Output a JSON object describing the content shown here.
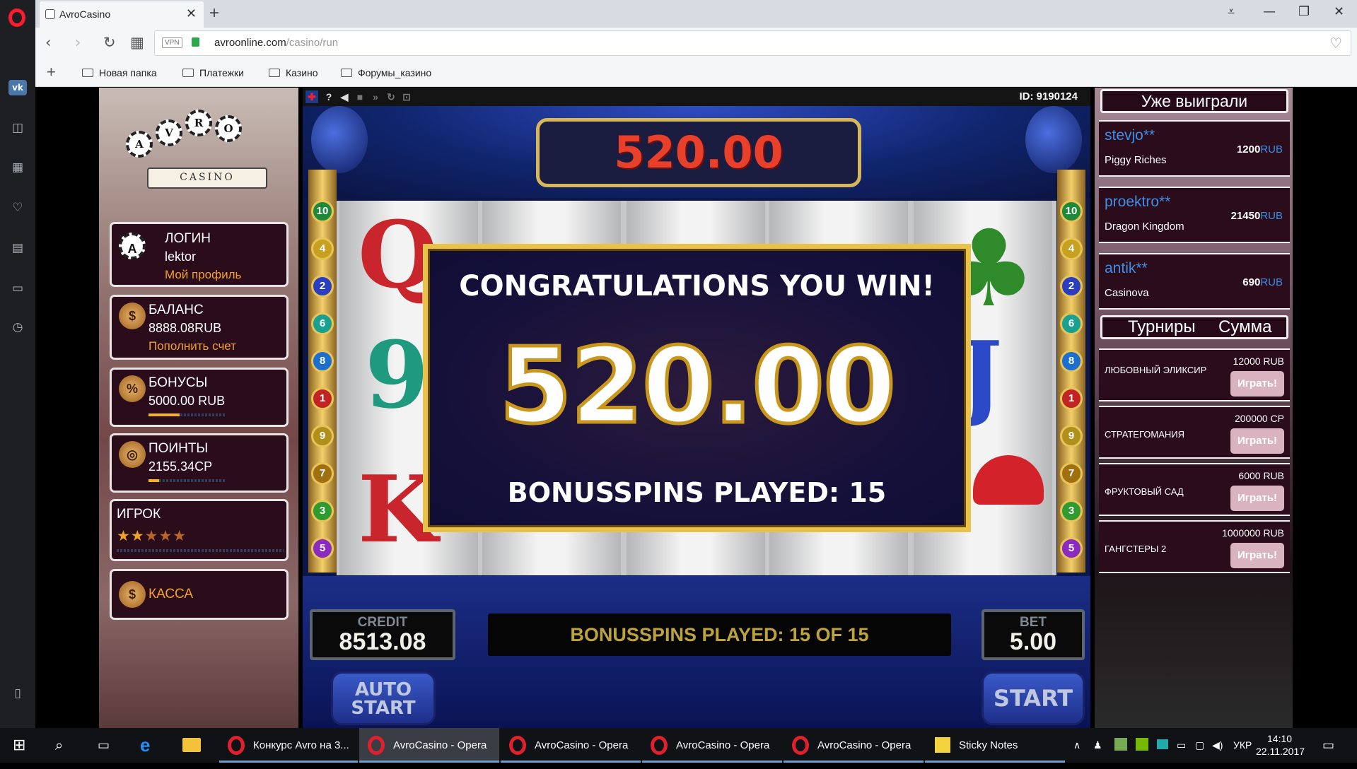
{
  "browser": {
    "tab_title": "AvroCasino",
    "url_host": "avroonline.com",
    "url_path": "/casino/run",
    "vpn_label": "VPN",
    "bookmarks": [
      "Новая папка",
      "Платежки",
      "Казино",
      "Форумы_казино"
    ]
  },
  "casino": {
    "logo_text": "CASINO",
    "logo_letters": [
      "A",
      "V",
      "R",
      "O"
    ],
    "login": {
      "title": "ЛОГИН",
      "user": "lektor",
      "link": "Мой профиль"
    },
    "balance": {
      "title": "БАЛАНС",
      "value": "8888.08RUB",
      "link": "Пополнить счет"
    },
    "bonus": {
      "title": "БОНУСЫ",
      "value": "5000.00 RUB",
      "progress": 0.4
    },
    "points": {
      "title": "ПОИНТЫ",
      "value": "2155.34CP",
      "progress": 0.14
    },
    "player": {
      "title": "ИГРОК",
      "stars": "★★★★★",
      "stars_rated": 2
    },
    "cashier": {
      "title": "КАССА"
    }
  },
  "game": {
    "id_label": "ID: 9190124",
    "top_win": "520.00",
    "popup_title": "CONGRATULATIONS YOU WIN!",
    "popup_amount": "520.00",
    "popup_spins": "BONUSSPINS PLAYED: 15",
    "line_numbers": [
      "10",
      "4",
      "2",
      "6",
      "8",
      "1",
      "9",
      "7",
      "3",
      "5"
    ],
    "credit_label": "CREDIT",
    "credit_value": "8513.08",
    "status": "BONUSSPINS PLAYED: 15 OF 15",
    "bet_label": "BET",
    "bet_value": "5.00",
    "auto_start_line1": "AUTO",
    "auto_start_line2": "START",
    "start": "START"
  },
  "winners": {
    "heading": "Уже выиграли",
    "items": [
      {
        "name": "stevjo**",
        "game": "Piggy Riches",
        "amount": "1200",
        "currency": "RUB"
      },
      {
        "name": "proektro**",
        "game": "Dragon Kingdom",
        "amount": "21450",
        "currency": "RUB"
      },
      {
        "name": "antik**",
        "game": "Casinova",
        "amount": "690",
        "currency": "RUB"
      }
    ]
  },
  "tournaments": {
    "heading_left": "Турниры",
    "heading_right": "Сумма",
    "play_label": "Играть!",
    "items": [
      {
        "name": "ЛЮБОВНЫЙ ЭЛИКСИР",
        "prize": "12000 RUB"
      },
      {
        "name": "СТРАТЕГОМАНИЯ",
        "prize": "200000 CP"
      },
      {
        "name": "ФРУКТОВЫЙ САД",
        "prize": "6000 RUB"
      },
      {
        "name": "ГАНГСТЕРЫ 2",
        "prize": "1000000 RUB"
      }
    ]
  },
  "taskbar": {
    "apps": [
      "Конкурс Avro на 3...",
      "AvroCasino - Opera",
      "AvroCasino - Opera",
      "AvroCasino - Opera",
      "AvroCasino - Opera",
      "Sticky Notes"
    ],
    "lang": "УКР",
    "time": "14:10",
    "date": "22.11.2017"
  },
  "colors": {
    "accent_gold": "#e9c24b",
    "panel": "#2b0c1a",
    "link_orange": "#f1a22c",
    "winner_blue": "#3d8ee8"
  }
}
